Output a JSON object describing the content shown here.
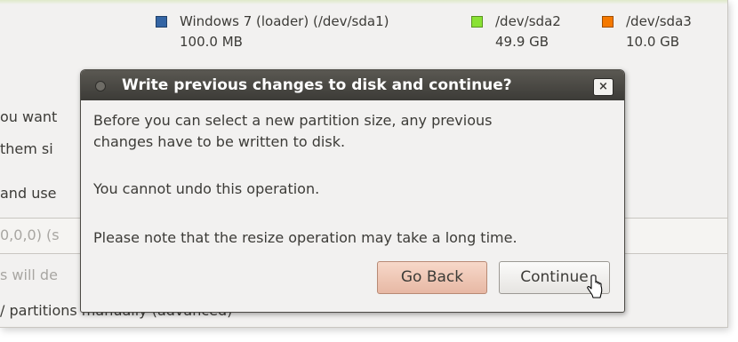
{
  "background": {
    "legend": [
      {
        "name": "Windows 7 (loader) (/dev/sda1)",
        "size": "100.0 MB",
        "color": "#3465a4"
      },
      {
        "name": "/dev/sda2",
        "size": "49.9 GB",
        "color": "#8ae234"
      },
      {
        "name": "/dev/sda3",
        "size": "10.0 GB",
        "color": "#f57900"
      }
    ],
    "fragments": [
      "ou want",
      "them si",
      "and use",
      "0,0,0) (s",
      "s will de",
      "/ partitions manually (advanced)"
    ]
  },
  "dialog": {
    "title": "Write previous changes to disk and continue?",
    "close_label": "×",
    "message_1": "Before you can select a new partition size, any previous",
    "message_2": "changes have to be written to disk.",
    "message_3": "You cannot undo this operation.",
    "message_4": "Please note that the resize operation may take a long time.",
    "go_back_label": "Go Back",
    "continue_label": "Continue"
  },
  "colors": {
    "titlebar": "#3c3b37",
    "go_back_highlight": "#e7b8a4"
  }
}
